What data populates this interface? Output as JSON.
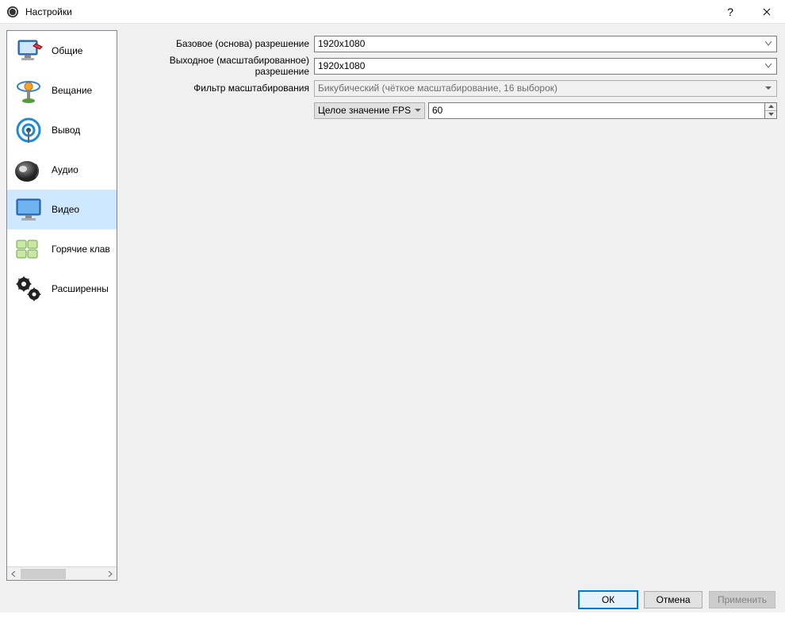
{
  "titlebar": {
    "title": "Настройки"
  },
  "sidebar": {
    "items": [
      {
        "label": "Общие"
      },
      {
        "label": "Вещание"
      },
      {
        "label": "Вывод"
      },
      {
        "label": "Аудио"
      },
      {
        "label": "Видео"
      },
      {
        "label": "Горячие клав"
      },
      {
        "label": "Расширенны"
      }
    ]
  },
  "form": {
    "base_resolution": {
      "label": "Базовое (основа) разрешение",
      "value": "1920x1080"
    },
    "output_resolution": {
      "label": "Выходное (масштабированное) разрешение",
      "value": "1920x1080"
    },
    "downscale_filter": {
      "label": "Фильтр масштабирования",
      "value": "Бикубический (чёткое масштабирование, 16 выборок)"
    },
    "fps_type": {
      "label": "Целое значение FPS"
    },
    "fps_value": "60"
  },
  "footer": {
    "ok": "ОК",
    "cancel": "Отмена",
    "apply": "Применить"
  }
}
